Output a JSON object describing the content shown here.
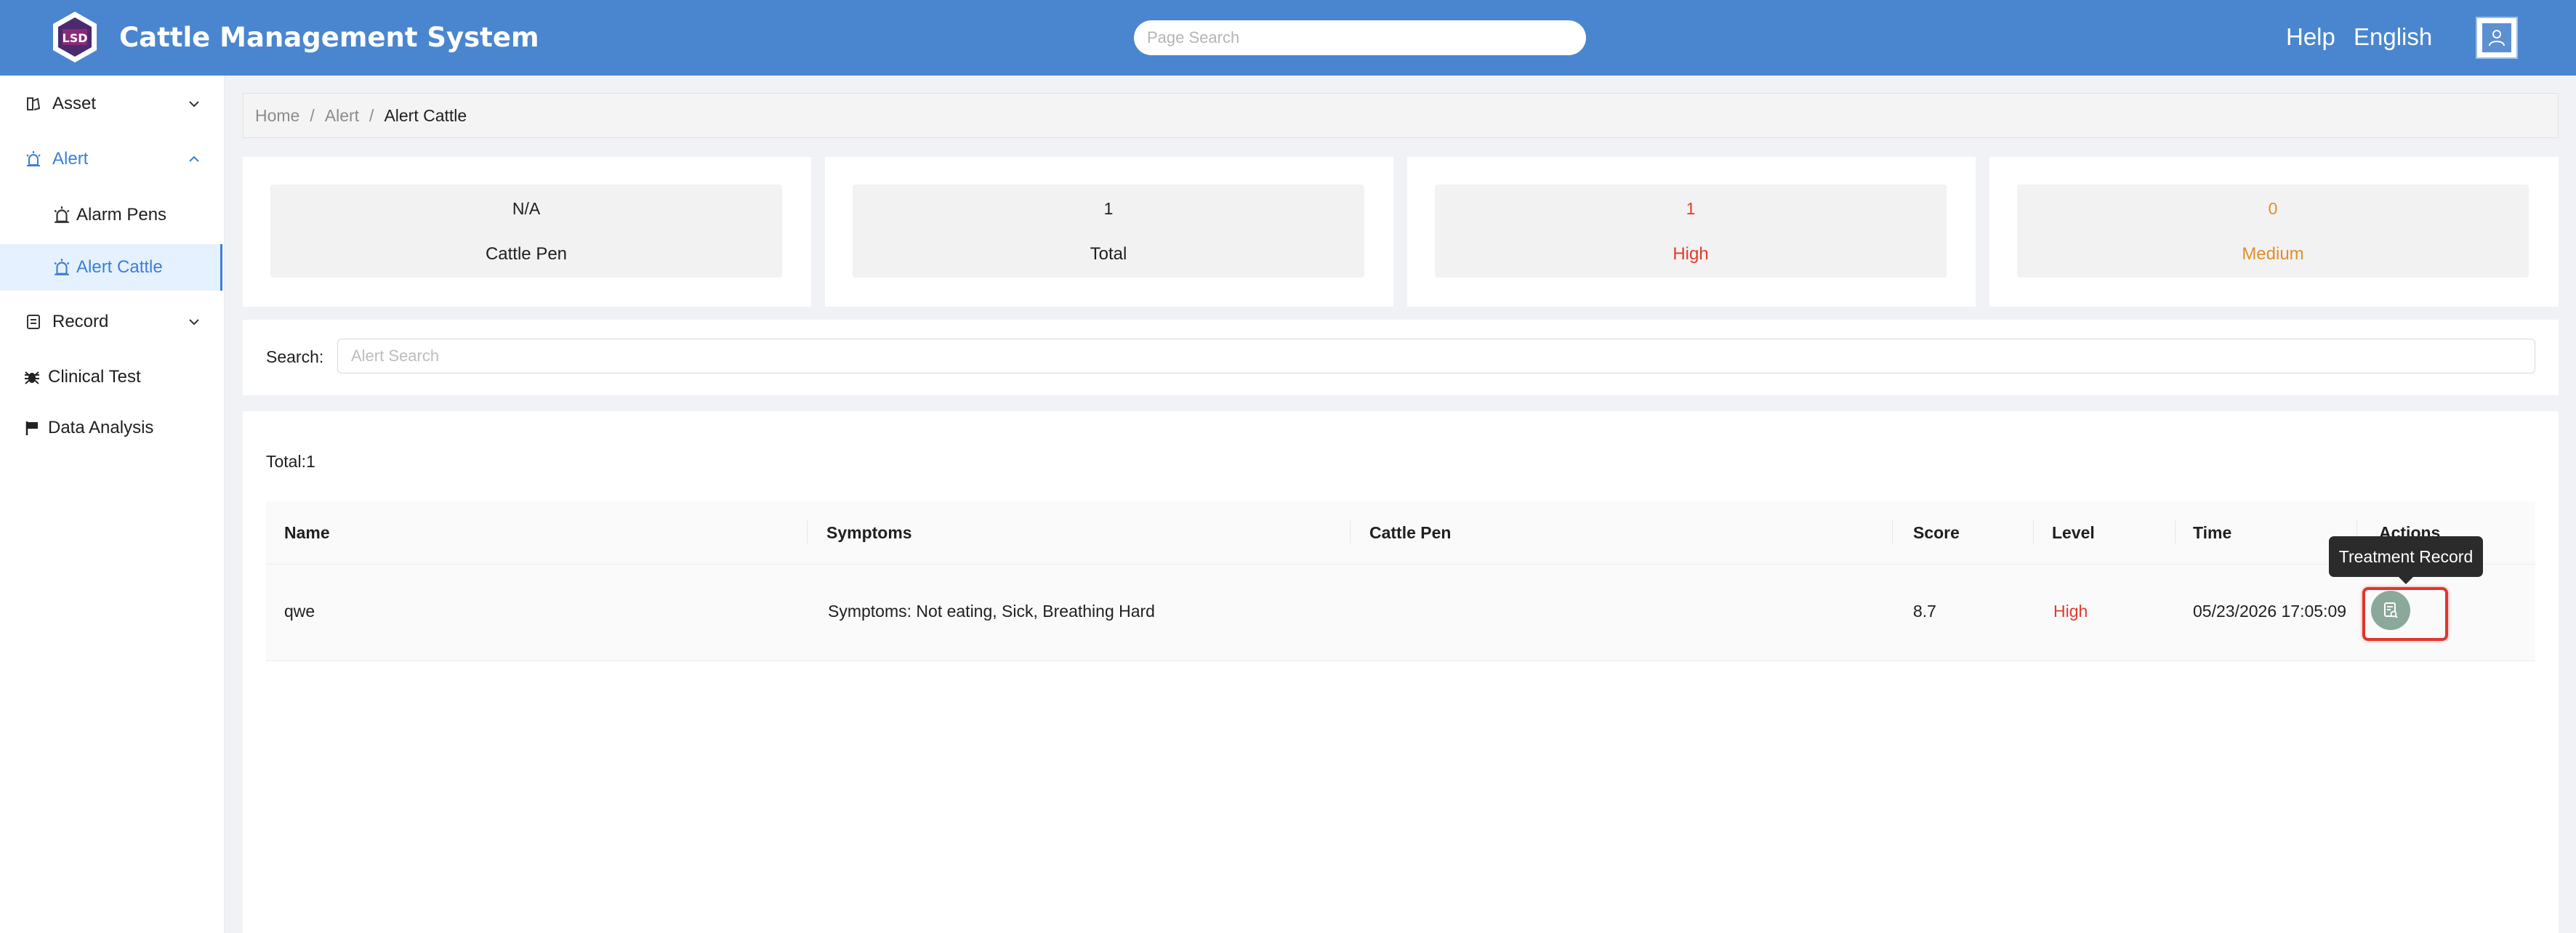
{
  "header": {
    "app_title": "Cattle Management System",
    "logo_text": "LSD",
    "search_placeholder": "Page Search",
    "help_label": "Help",
    "language_label": "English"
  },
  "sidebar": {
    "items": [
      {
        "label": "Asset",
        "icon": "asset-icon"
      },
      {
        "label": "Alert",
        "icon": "alarm-icon"
      },
      {
        "label": "Alarm Pens",
        "icon": "alarm-icon"
      },
      {
        "label": "Alert Cattle",
        "icon": "alarm-icon"
      },
      {
        "label": "Record",
        "icon": "record-icon"
      },
      {
        "label": "Clinical Test",
        "icon": "bug-icon"
      },
      {
        "label": "Data Analysis",
        "icon": "flag-icon"
      }
    ]
  },
  "breadcrumb": [
    "Home",
    "Alert",
    "Alert Cattle"
  ],
  "stats": [
    {
      "value": "N/A",
      "label": "Cattle Pen"
    },
    {
      "value": "1",
      "label": "Total"
    },
    {
      "value": "1",
      "label": "High"
    },
    {
      "value": "0",
      "label": "Medium"
    }
  ],
  "search": {
    "label": "Search:",
    "placeholder": "Alert Search"
  },
  "table": {
    "total_label": "Total:1",
    "columns": [
      "Name",
      "Symptoms",
      "Cattle Pen",
      "Score",
      "Level",
      "Time",
      "Actions"
    ],
    "rows": [
      {
        "name": "qwe",
        "symptoms": "Symptoms: Not eating, Sick, Breathing Hard",
        "cattle_pen": "",
        "score": "8.7",
        "level": "High",
        "time": "05/23/2026 17:05:09"
      }
    ]
  },
  "tooltip": "Treatment Record",
  "colors": {
    "header_bg": "#4a86cf",
    "accent": "#3b7fd8",
    "high": "#e23a2e",
    "medium": "#e0902a",
    "action_button": "#8aa99b",
    "highlight": "#e0362d"
  }
}
